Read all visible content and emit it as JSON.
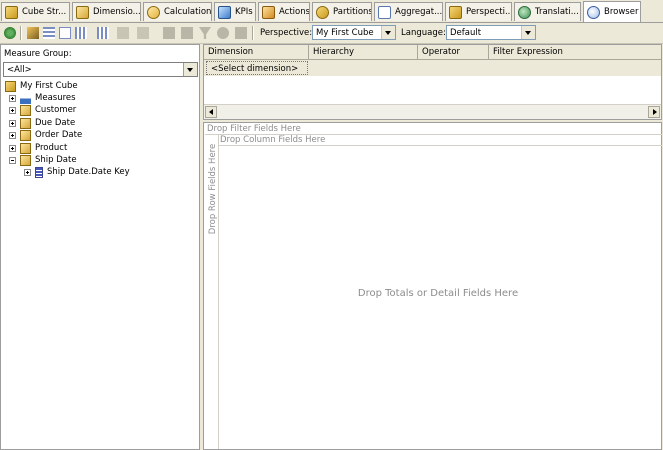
{
  "tabs": [
    {
      "label": "Cube Str...",
      "icon": "cube-structure-icon"
    },
    {
      "label": "Dimensio...",
      "icon": "dimension-usage-icon"
    },
    {
      "label": "Calculations",
      "icon": "calculations-icon"
    },
    {
      "label": "KPIs",
      "icon": "kpi-icon"
    },
    {
      "label": "Actions",
      "icon": "actions-icon"
    },
    {
      "label": "Partitions",
      "icon": "partitions-icon"
    },
    {
      "label": "Aggregat...",
      "icon": "aggregations-icon"
    },
    {
      "label": "Perspecti...",
      "icon": "perspectives-icon"
    },
    {
      "label": "Translati...",
      "icon": "translations-icon"
    },
    {
      "label": "Browser",
      "icon": "browser-icon",
      "active": true
    }
  ],
  "toolbar": {
    "perspective_label": "Perspective:",
    "perspective_value": "My First Cube",
    "language_label": "Language:",
    "language_value": "Default"
  },
  "left_pane": {
    "measure_group_label": "Measure Group:",
    "measure_group_value": "<All>",
    "tree": [
      {
        "label": "My First Cube",
        "icon": "cube-icon",
        "level": 0
      },
      {
        "label": "Measures",
        "icon": "measures-icon",
        "level": 1,
        "expander": "plus"
      },
      {
        "label": "Customer",
        "icon": "dimension-icon",
        "level": 1,
        "expander": "plus"
      },
      {
        "label": "Due Date",
        "icon": "dimension-icon",
        "level": 1,
        "expander": "plus"
      },
      {
        "label": "Order Date",
        "icon": "dimension-icon",
        "level": 1,
        "expander": "plus"
      },
      {
        "label": "Product",
        "icon": "dimension-icon",
        "level": 1,
        "expander": "plus"
      },
      {
        "label": "Ship Date",
        "icon": "dimension-icon",
        "level": 1,
        "expander": "minus"
      },
      {
        "label": "Ship Date.Date Key",
        "icon": "hierarchy-icon",
        "level": 2,
        "expander": "plus"
      }
    ]
  },
  "filter_grid": {
    "columns": [
      "Dimension",
      "Hierarchy",
      "Operator",
      "Filter Expression"
    ],
    "select_dimension": "<Select dimension>"
  },
  "pivot": {
    "filter_drop": "Drop Filter Fields Here",
    "column_drop": "Drop Column Fields Here",
    "row_drop": "Drop Row Fields Here",
    "totals_drop": "Drop Totals or Detail Fields Here"
  },
  "colors": {
    "chrome": "#ece9d8",
    "border": "#9d9d9d",
    "drop_text": "#8c8c8c"
  }
}
